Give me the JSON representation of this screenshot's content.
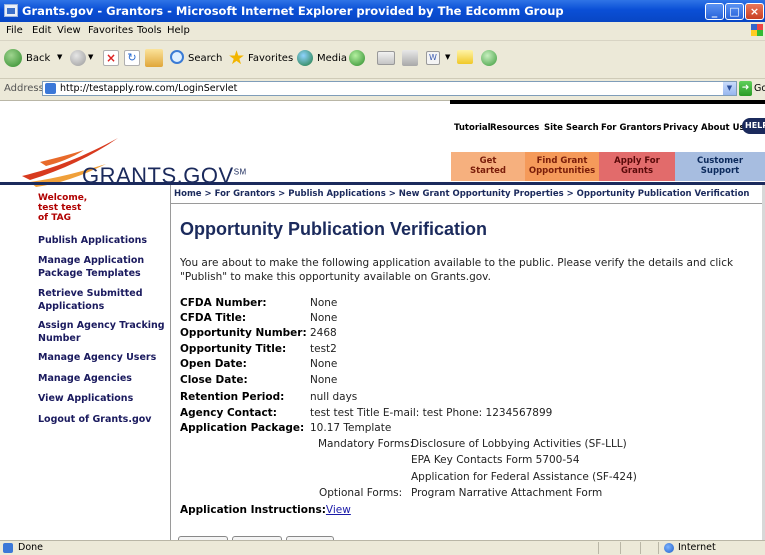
{
  "window": {
    "title": "Grants.gov - Grantors - Microsoft Internet Explorer provided by The Edcomm Group"
  },
  "menu": [
    "File",
    "Edit",
    "View",
    "Favorites",
    "Tools",
    "Help"
  ],
  "toolbar": {
    "back": "Back",
    "search": "Search",
    "favorites": "Favorites",
    "media": "Media"
  },
  "address": {
    "label": "Address",
    "url": "http://testapply.row.com/LoginServlet",
    "go": "Go"
  },
  "site": {
    "logo": "GRANTS.GOV",
    "logo_mark": "SM",
    "top_nav": [
      "Tutorial",
      "Resources",
      "Site Search",
      "For Grantors",
      "Privacy",
      "About Us",
      "HELP"
    ],
    "tabs": [
      {
        "line1": "Get",
        "line2": "Started",
        "color": "#f6b07e"
      },
      {
        "line1": "Find Grant",
        "line2": "Opportunities",
        "color": "#f59a5a"
      },
      {
        "line1": "Apply For",
        "line2": "Grants",
        "color": "#e26b6b"
      },
      {
        "line1": "Customer",
        "line2": "Support",
        "color": "#a7bde0"
      }
    ]
  },
  "sidebar": {
    "welcome": [
      "Welcome,",
      "test test",
      "of TAG"
    ],
    "items": [
      {
        "label": "Publish Applications"
      },
      {
        "label": "Manage Application Package Templates"
      },
      {
        "label": "Retrieve Submitted Applications"
      },
      {
        "label": "Assign Agency Tracking Number"
      },
      {
        "label": "Manage Agency Users"
      },
      {
        "label": "Manage Agencies"
      },
      {
        "label": "View Applications"
      },
      {
        "label": "Logout of Grants.gov"
      }
    ]
  },
  "breadcrumb": "Home > For Grantors > Publish Applications > New Grant Opportunity Properties > Opportunity Publication Verification",
  "main": {
    "title": "Opportunity Publication Verification",
    "intro": "You are about to make the following application available to the public. Please verify the details and click \"Publish\" to make this opportunity available on Grants.gov.",
    "fields": [
      {
        "label": "CFDA Number:",
        "value": "None"
      },
      {
        "label": "CFDA Title:",
        "value": "None"
      },
      {
        "label": "Opportunity Number:",
        "value": "2468"
      },
      {
        "label": "Opportunity Title:",
        "value": "test2"
      },
      {
        "label": "Open Date:",
        "value": "None"
      },
      {
        "label": "Close Date:",
        "value": "None"
      },
      {
        "label": "Retention Period:",
        "value": "null days"
      },
      {
        "label": "Agency Contact:",
        "value": "test test Title E-mail: test Phone: 1234567899"
      },
      {
        "label": "Application Package:",
        "value": "10.17 Template"
      }
    ],
    "mandatory_label": "Mandatory Forms:",
    "mandatory_forms": [
      "Disclosure of Lobbying Activities (SF-LLL)",
      "EPA Key Contacts Form 5700-54",
      "Application for Federal Assistance (SF-424)"
    ],
    "optional_label": "Optional Forms:",
    "optional_forms": [
      "Program Narrative Attachment Form"
    ],
    "instructions_label": "Application Instructions:",
    "instructions_link": "View"
  },
  "status": {
    "text": "Done",
    "zone": "Internet"
  },
  "colors": {
    "titlebar": "#0a4fd6",
    "chrome": "#ece9d8",
    "brand_navy": "#1b2a5c",
    "welcome_red": "#b00000"
  }
}
